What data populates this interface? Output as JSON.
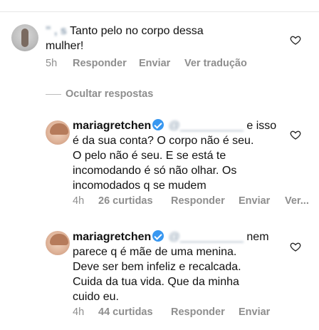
{
  "comment1": {
    "username": "\" ,  s",
    "text_line1": "Tanto pelo no corpo dessa",
    "text_line2": "mulher!",
    "time": "5h",
    "reply": "Responder",
    "send": "Enviar",
    "translate": "Ver tradução"
  },
  "hide_replies": "Ocultar respostas",
  "reply1": {
    "username": "mariagretchen",
    "mention": "@__________",
    "lines": [
      "e isso",
      "é da sua conta? O corpo não é seu.",
      "O pelo não é seu. E se está te",
      "incomodando é só não olhar. Os",
      "incomodados q se mudem"
    ],
    "time": "4h",
    "likes": "26 curtidas",
    "reply": "Responder",
    "send": "Enviar",
    "more": "Ver..."
  },
  "reply2": {
    "username": "mariagretchen",
    "mention": "@__________",
    "lines": [
      "nem",
      "parece q é mãe de uma menina.",
      "Deve ser bem infeliz e recalcada.",
      "Cuida da tua vida. Que da minha",
      "cuido eu."
    ],
    "time": "4h",
    "likes": "44 curtidas",
    "reply": "Responder",
    "send": "Enviar"
  },
  "icons": {
    "heart": "heart-icon",
    "verified": "verified-badge-icon"
  },
  "colors": {
    "meta": "#8e8e8e",
    "verified": "#3897f0",
    "blurred_mention": "#8a9db0"
  }
}
